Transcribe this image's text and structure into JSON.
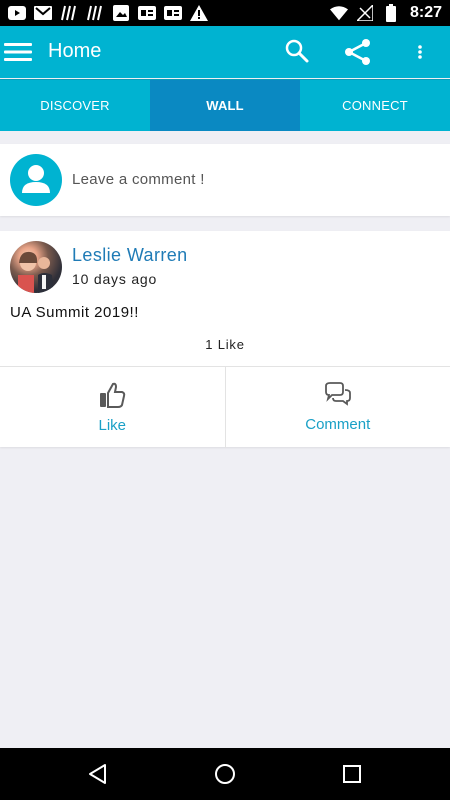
{
  "status_bar": {
    "time": "8:27",
    "left_icons": [
      "youtube-icon",
      "gmail-icon",
      "hashtag-icon",
      "hashtag-icon",
      "image-icon",
      "news-icon",
      "news-icon",
      "warning-icon"
    ],
    "right_icons": [
      "wifi-icon",
      "signal-icon",
      "battery-icon"
    ]
  },
  "app_bar": {
    "title": "Home",
    "background": "#00b3d1"
  },
  "tabs": [
    {
      "label": "DISCOVER"
    },
    {
      "label": "WALL",
      "active": true
    },
    {
      "label": "CONNECT"
    }
  ],
  "composer": {
    "placeholder": "Leave a comment !"
  },
  "post": {
    "author": "Leslie Warren",
    "time": "10 days ago",
    "body": "UA Summit 2019!!",
    "likes": "1 Like",
    "actions": {
      "like_label": "Like",
      "comment_label": "Comment"
    }
  },
  "colors": {
    "primary": "#00b3d1",
    "tab_active": "#0a89c2",
    "link": "#1f7bb6",
    "action": "#1aa0c6",
    "page_bg": "#efeff4"
  }
}
